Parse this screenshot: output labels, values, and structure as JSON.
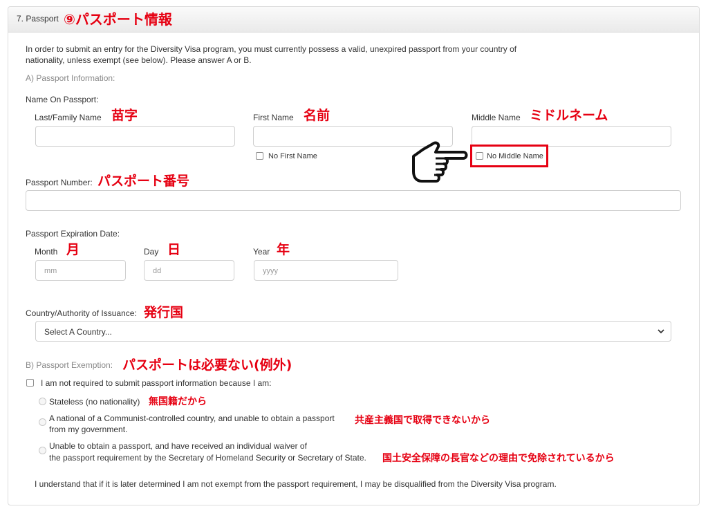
{
  "section": {
    "number_title": "7. Passport",
    "annotation": "⑨パスポート情報"
  },
  "intro": {
    "line1": "In order to submit an entry for the Diversity Visa program, you must currently possess a valid, unexpired passport from your country of",
    "line2": "nationality, unless exempt (see below). Please answer A or B."
  },
  "part_a": {
    "label": "A) Passport Information:",
    "name_on_passport": "Name On Passport:",
    "last_name": {
      "label": "Last/Family Name",
      "annotation": "苗字",
      "value": ""
    },
    "first_name": {
      "label": "First Name",
      "annotation": "名前",
      "value": "",
      "no_checkbox": "No First Name"
    },
    "middle_name": {
      "label": "Middle Name",
      "annotation": "ミドルネーム",
      "value": "",
      "no_checkbox": "No Middle Name"
    },
    "passport_number": {
      "label": "Passport Number:",
      "annotation": "パスポート番号",
      "value": ""
    },
    "expiration": {
      "label": "Passport Expiration Date:",
      "month": {
        "label": "Month",
        "annotation": "月",
        "placeholder": "mm"
      },
      "day": {
        "label": "Day",
        "annotation": "日",
        "placeholder": "dd"
      },
      "year": {
        "label": "Year",
        "annotation": "年",
        "placeholder": "yyyy"
      }
    },
    "country": {
      "label": "Country/Authority of Issuance:",
      "annotation": "発行国",
      "selected": "Select A Country..."
    }
  },
  "part_b": {
    "label": "B) Passport Exemption:",
    "annotation": "パスポートは必要ない(例外)",
    "checkbox_label": "I am not required to submit passport information because I am:",
    "options": [
      {
        "lines": [
          "Stateless (no nationality)"
        ],
        "annotation": "無国籍だから"
      },
      {
        "lines": [
          "A national of a Communist-controlled country, and unable to obtain a passport",
          "from my government."
        ],
        "annotation": "共産主義国で取得できないから"
      },
      {
        "lines": [
          "Unable to obtain a passport, and have received an individual waiver of",
          "the passport requirement by the Secretary of Homeland Security or Secretary of State."
        ],
        "annotation": "国土安全保障の長官などの理由で免除されているから"
      }
    ],
    "disclaimer": "I understand that if it is later determined I am not exempt from the passport requirement, I may be disqualified from the Diversity Visa program."
  },
  "colors": {
    "annotation_red": "#e60012",
    "border": "#cfcfcf"
  },
  "icons": {
    "pointer": "pointing-hand-icon",
    "dropdown": "chevron-down-icon"
  }
}
